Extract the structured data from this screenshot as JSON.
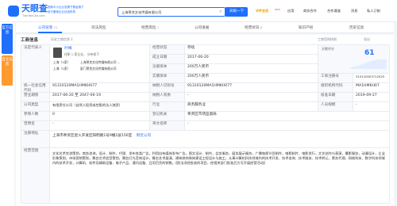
{
  "header": {
    "brand": "天眼查",
    "domain": "TianYanCha.com",
    "slogan_line1": "国家中小企业发展子基金旗下",
    "slogan_line2": "官方备案企业征信机构",
    "search_value": "上海莱克文化传媒有限公司",
    "search_button": "天眼一下",
    "nav": {
      "vip": "VIP会员",
      "vip_badge": "NEW",
      "app": "应用",
      "business": "商务合作",
      "cooperation": "合作通道",
      "message": "消息",
      "user": "私人订制"
    }
  },
  "sidebar": {
    "tab1": "官方信息",
    "tab2": "自主信息"
  },
  "tabs": [
    {
      "label": "公司背景",
      "count": "21",
      "active": true
    },
    {
      "label": "司法风险",
      "count": "",
      "active": false
    },
    {
      "label": "经营风险",
      "count": "1",
      "active": false
    },
    {
      "label": "公司发展",
      "count": "",
      "active": false
    },
    {
      "label": "经营状况",
      "count": "8",
      "active": false
    },
    {
      "label": "知识产权",
      "count": "",
      "active": false
    },
    {
      "label": "历史信息",
      "count": "",
      "active": false
    }
  ],
  "section": {
    "title": "工商信息",
    "help": "历史工商信息 1",
    "action1": "工商官网快照",
    "action2": "导出"
  },
  "table": {
    "legal_rep_label": "法定代表人",
    "legal_rep_name": "叶梅",
    "legal_rep_role": "任职 1 家企业， 分布如下",
    "holdings": [
      {
        "city": "上海（1家）",
        "company": "上海莱克文化传媒有限公司 ..."
      },
      {
        "city": "上海（1家）",
        "company": "厦门莱克文化传媒有限公司"
      }
    ],
    "status_label": "经营状态",
    "status_value": "存续",
    "established_label": "成立日期",
    "established_value": "2017-06-20",
    "reg_capital_label": "注册资本",
    "reg_capital_value": "200万人民币",
    "paid_capital_label": "实缴资本",
    "paid_capital_value": "200万人民币",
    "score_label": "天眼评分",
    "score_value": "61",
    "reg_no_label": "工商注册号",
    "reg_no_value": "310120003712025",
    "credit_code_label": "统一社会信用代码",
    "credit_code_value": "91310120MA1HMKH077",
    "tax_id_label": "纳税人识别号",
    "tax_id_value": "91310120MA1HMKH077",
    "org_code_label": "组织机构代码",
    "org_code_value": "MA1HMKH07",
    "term_label": "营业期限",
    "term_value": "2017-06-20 至 2047-06-19",
    "taxpayer_label": "纳税人资质",
    "taxpayer_value": "-",
    "approval_label": "核准日期",
    "approval_value": "2019-09-27",
    "company_type_label": "公司类型",
    "company_type_value": "有限责任公司（自然人投资或控股的法人独资）",
    "industry_label": "行业",
    "industry_value": "商务服务业",
    "staff_label": "人员规模",
    "staff_value": "-",
    "insured_label": "参保人数",
    "insured_value": "0",
    "authority_label": "登记机关",
    "authority_value": "奉贤区市场监督局",
    "former_label": "曾用名",
    "former_value": "-",
    "english_label": "英文名称",
    "english_value": "-",
    "address_label": "注册地址",
    "address_value": "上海市奉贤区星火开发区阳明路1号9幢1层156室",
    "address_link": "附近公司",
    "scope_label": "经营范围",
    "scope_value": "文化艺术交流策划，商务咨询，设计、制作、代理、发布各类广告，利用自有媒体发布广告，图文设计、制作，会务服务，展览展示服务，广播电视节目制作，电影制片，电影发行，文艺创作与表演，摄影服务，动漫设计，企业形象策划，市场营销策划，舞台艺术造型策划，舞台灯光音响设计，舞台艺术展演，建筑装饰装修建设工程设计与施工，从事计算机科技领域内的技术开发、技术咨询、技术服务、技术转让，票务代理，网络科技、数字科技领域内的技术开发，计算机、软件及辅助设备、电子产品、通讯设备、日用百货的销售。【依法须经批准的项目，经相关部门批准后方可开展经营活动】"
  },
  "colors": {
    "accent": "#1f6fff",
    "sidebar_tab1": "#1f6fff",
    "sidebar_tab2": "#ff9a2e"
  }
}
